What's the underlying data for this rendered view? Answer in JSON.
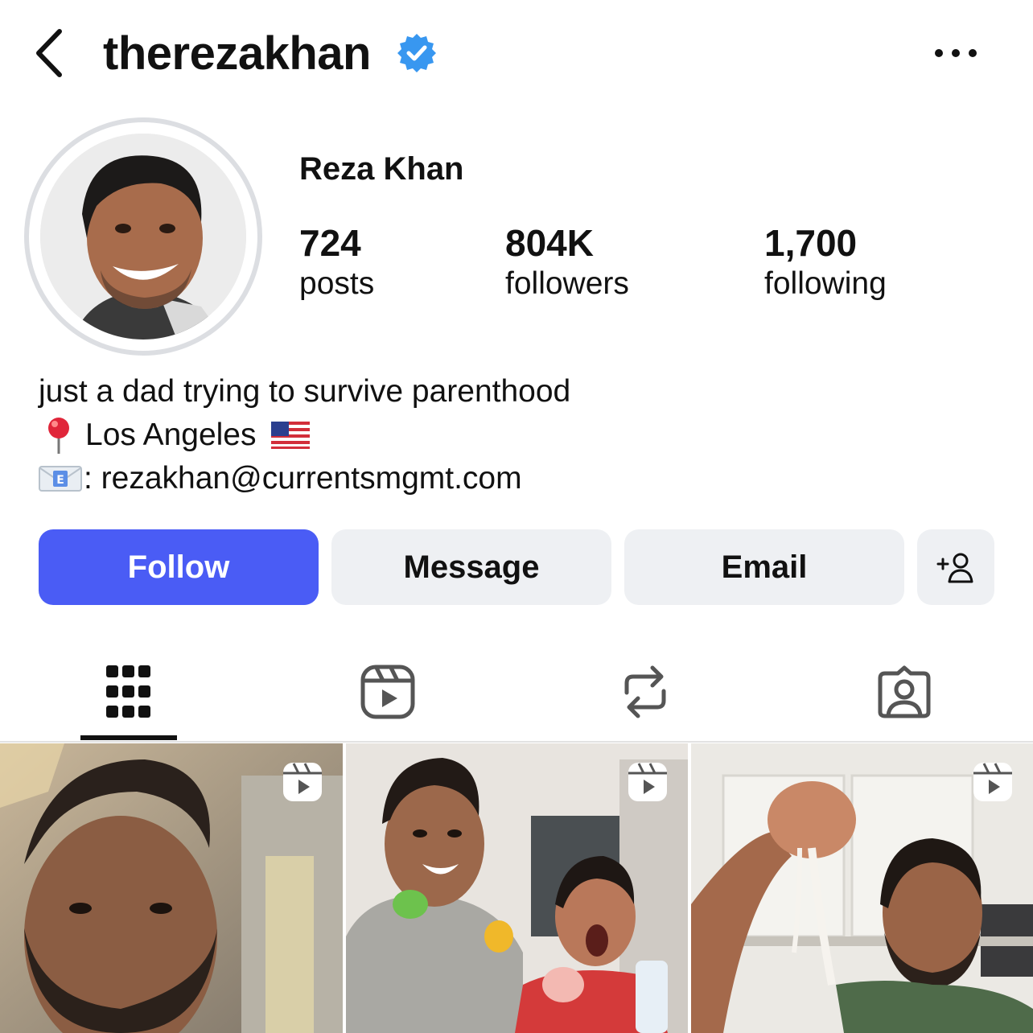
{
  "header": {
    "username": "therezakhan",
    "verified": true
  },
  "profile": {
    "display_name": "Reza Khan",
    "stats": {
      "posts": {
        "value": "724",
        "label": "posts"
      },
      "followers": {
        "value": "804K",
        "label": "followers"
      },
      "following": {
        "value": "1,700",
        "label": "following"
      }
    },
    "bio": {
      "line1": "just a dad trying to survive parenthood",
      "line2": "Los Angeles",
      "line3": ": rezakhan@currentsmgmt.com"
    }
  },
  "actions": {
    "follow_label": "Follow",
    "message_label": "Message",
    "email_label": "Email"
  },
  "tabs": [
    {
      "icon": "grid-icon",
      "active": true
    },
    {
      "icon": "reels-icon",
      "active": false
    },
    {
      "icon": "reposts-icon",
      "active": false
    },
    {
      "icon": "tagged-icon",
      "active": false
    }
  ],
  "posts": [
    {
      "type": "reel"
    },
    {
      "type": "reel"
    },
    {
      "type": "reel"
    }
  ],
  "colors": {
    "follow_button": "#4a5cf5",
    "secondary_button": "#eef0f3",
    "verified_badge": "#3897f0"
  }
}
